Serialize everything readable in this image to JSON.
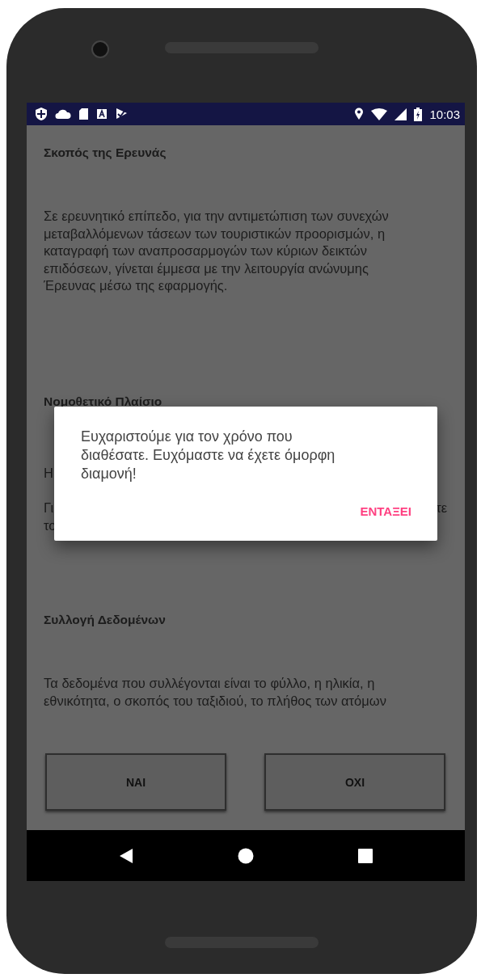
{
  "status_bar": {
    "time": "10:03"
  },
  "sections": [
    {
      "heading": "Σκοπός της Ερευνάς",
      "paragraph": "Σε ερευνητικό επίπεδο, για την αντιμετώπιση των συνεχών μεταβαλλόμενων τάσεων των τουριστικών προορισμών, η καταγραφή των αναπροσαρμογών των κύριων δεικτών επιδόσεων, γίνεται έμμεσα με την λειτουργία ανώνυμης Έρευνας μέσω της εφαρμογής."
    },
    {
      "heading": "Νομοθετικό Πλαίσιο",
      "fragments": [
        {
          "left": "Η"
        },
        {
          "left": "Γι",
          "right": "τε"
        },
        {
          "left": "το"
        }
      ]
    },
    {
      "heading": "Συλλογή Δεδομένων",
      "paragraph": "Τα δεδομένα που συλλέγονται είναι το φύλλο, η ηλικία, η εθνικότητα, ο σκοπός του ταξιδιού, το πλήθος των ατόμων"
    }
  ],
  "buttons": [
    "ΝΑΙ",
    "ΟΧΙ"
  ],
  "dialog": {
    "message": "Ευχαριστούμε για τον χρόνο που διαθέσατε. Ευχόμαστε να έχετε όμορφη διαμονή!",
    "action": "ΕΝΤΑΞΕΙ"
  }
}
